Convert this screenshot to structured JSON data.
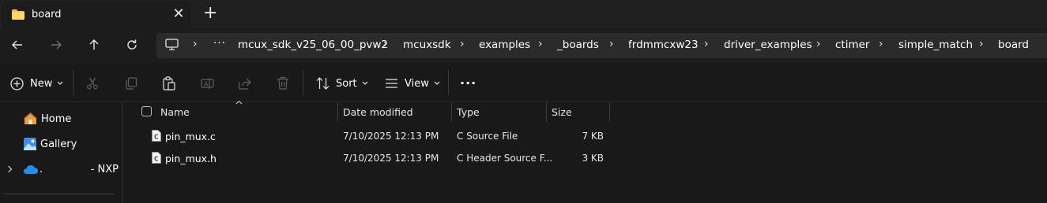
{
  "tab": {
    "title": "board",
    "close_glyph": "✕",
    "new_tab_glyph": "+"
  },
  "breadcrumbs": [
    "mcux_sdk_v25_06_00_pvw2",
    "mcuxsdk",
    "examples",
    "_boards",
    "frdmmcxw23",
    "driver_examples",
    "ctimer",
    "simple_match",
    "board"
  ],
  "breadcrumb_separator": "›",
  "breadcrumb_more": "···",
  "toolbar": {
    "new_label": "New",
    "sort_label": "Sort",
    "view_label": "View",
    "more_glyph": "···"
  },
  "sidebar": {
    "items": [
      {
        "label": "Home",
        "icon": "home-icon"
      },
      {
        "label": "Gallery",
        "icon": "gallery-icon"
      },
      {
        "label": ".",
        "suffix": "- NXP",
        "icon": "onedrive-cloud-icon"
      }
    ]
  },
  "columns": [
    "Name",
    "Date modified",
    "Type",
    "Size"
  ],
  "files": [
    {
      "name": "pin_mux.c",
      "date": "7/10/2025 12:13 PM",
      "type": "C Source File",
      "size": "7 KB",
      "icon_letter": "C"
    },
    {
      "name": "pin_mux.h",
      "date": "7/10/2025 12:13 PM",
      "type": "C Header Source F...",
      "size": "3 KB",
      "icon_letter": "C"
    }
  ],
  "colors": {
    "accent": "#4cc2ff",
    "folder": "#f5c342",
    "background": "#191919"
  }
}
